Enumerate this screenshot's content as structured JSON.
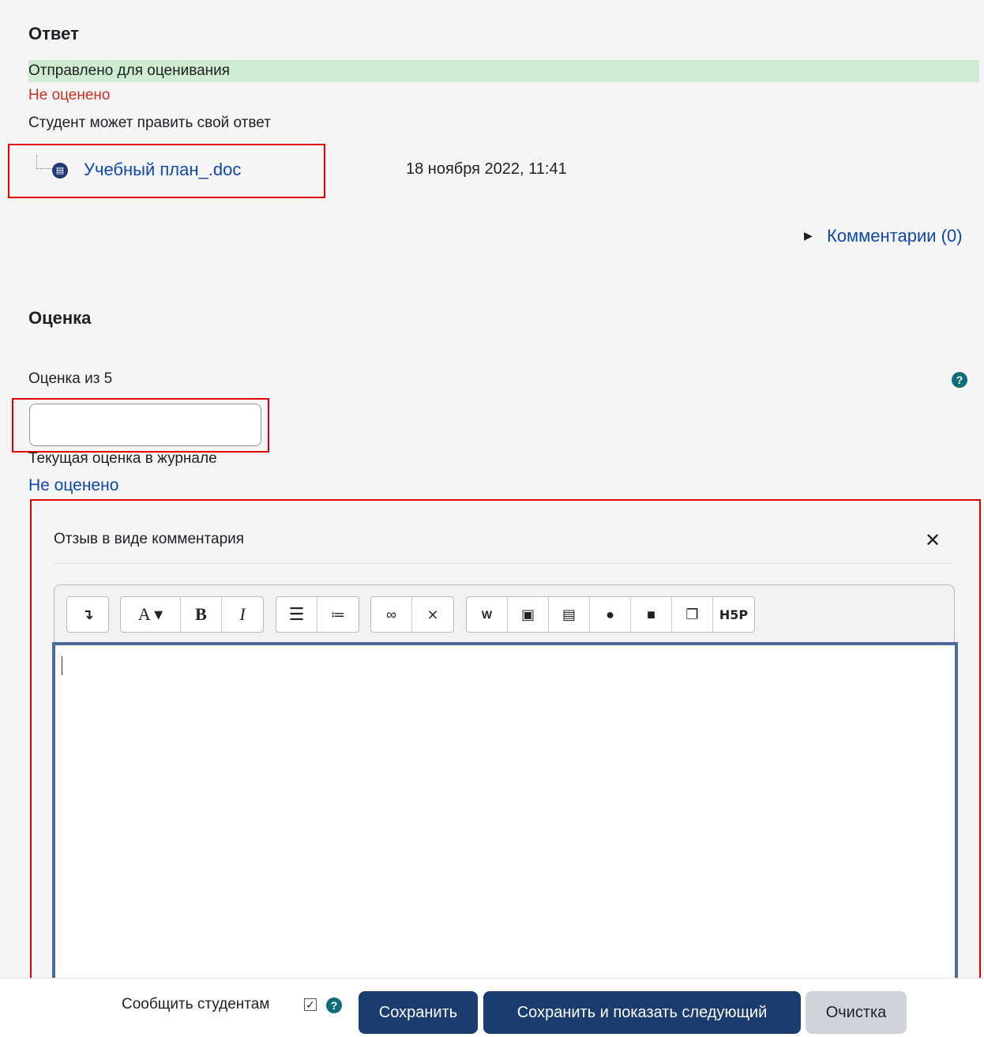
{
  "answer": {
    "heading": "Ответ",
    "status_submitted": "Отправлено для оценивания",
    "status_grade": "Не оценено",
    "status_edit": "Студент может править свой ответ",
    "file": {
      "name": "Учебный план_.doc",
      "date": "18 ноября 2022, 11:41"
    },
    "comments_link": "Комментарии (0)"
  },
  "grade": {
    "heading": "Оценка",
    "label": "Оценка из 5",
    "input_value": "",
    "current_label": "Текущая оценка в журнале",
    "current_value": "Не оценено"
  },
  "feedback": {
    "title": "Отзыв в виде комментария",
    "toolbar": [
      [
        "collapse-icon"
      ],
      [
        "font-style-icon",
        "bold-icon",
        "italic-icon"
      ],
      [
        "bullet-list-icon",
        "numbered-list-icon"
      ],
      [
        "link-icon",
        "unlink-icon"
      ],
      [
        "word-import-icon",
        "image-icon",
        "media-icon",
        "microphone-icon",
        "video-icon",
        "manage-files-icon",
        "h5p-icon"
      ]
    ],
    "body_text": ""
  },
  "footer": {
    "notify_label": "Сообщить студентам",
    "notify_checked": true,
    "save_label": "Сохранить",
    "save_next_label": "Сохранить и показать следующий",
    "reset_label": "Очистка"
  },
  "colors": {
    "primary": "#1a3c6e",
    "link": "#0f47ad",
    "danger": "#ca3120",
    "success_bg": "#cfecd2",
    "highlight_box": "#e00000"
  }
}
